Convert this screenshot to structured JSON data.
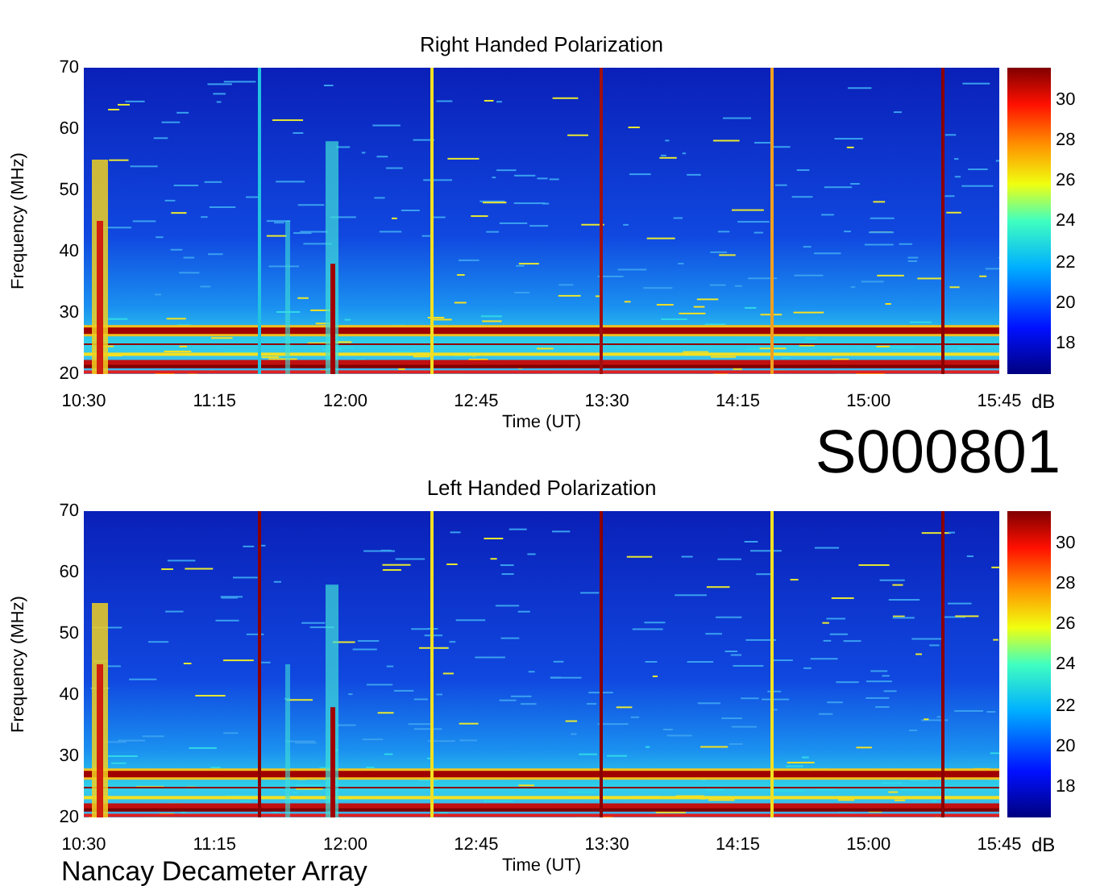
{
  "panels": [
    {
      "kind": "right",
      "title": "Right Handed Polarization",
      "ylabel": "Frequency (MHz)",
      "yticks": [
        "70",
        "60",
        "50",
        "40",
        "30",
        "20"
      ],
      "xticks": [
        "10:30",
        "11:15",
        "12:00",
        "12:45",
        "13:30",
        "14:15",
        "15:00",
        "15:45"
      ],
      "xlabel": "Time (UT)",
      "colorbar_ticks": [
        "30",
        "28",
        "26",
        "24",
        "22",
        "20",
        "18"
      ],
      "colorbar_unit": "dB"
    },
    {
      "kind": "left",
      "title": "Left Handed Polarization",
      "ylabel": "Frequency (MHz)",
      "yticks": [
        "70",
        "60",
        "50",
        "40",
        "30",
        "20"
      ],
      "xticks": [
        "10:30",
        "11:15",
        "12:00",
        "12:45",
        "13:30",
        "14:15",
        "15:00",
        "15:45"
      ],
      "xlabel": "Time (UT)",
      "colorbar_ticks": [
        "30",
        "28",
        "26",
        "24",
        "22",
        "20",
        "18"
      ],
      "colorbar_unit": "dB"
    }
  ],
  "event_id": "S000801",
  "footer": "Nancay Decameter Array"
}
